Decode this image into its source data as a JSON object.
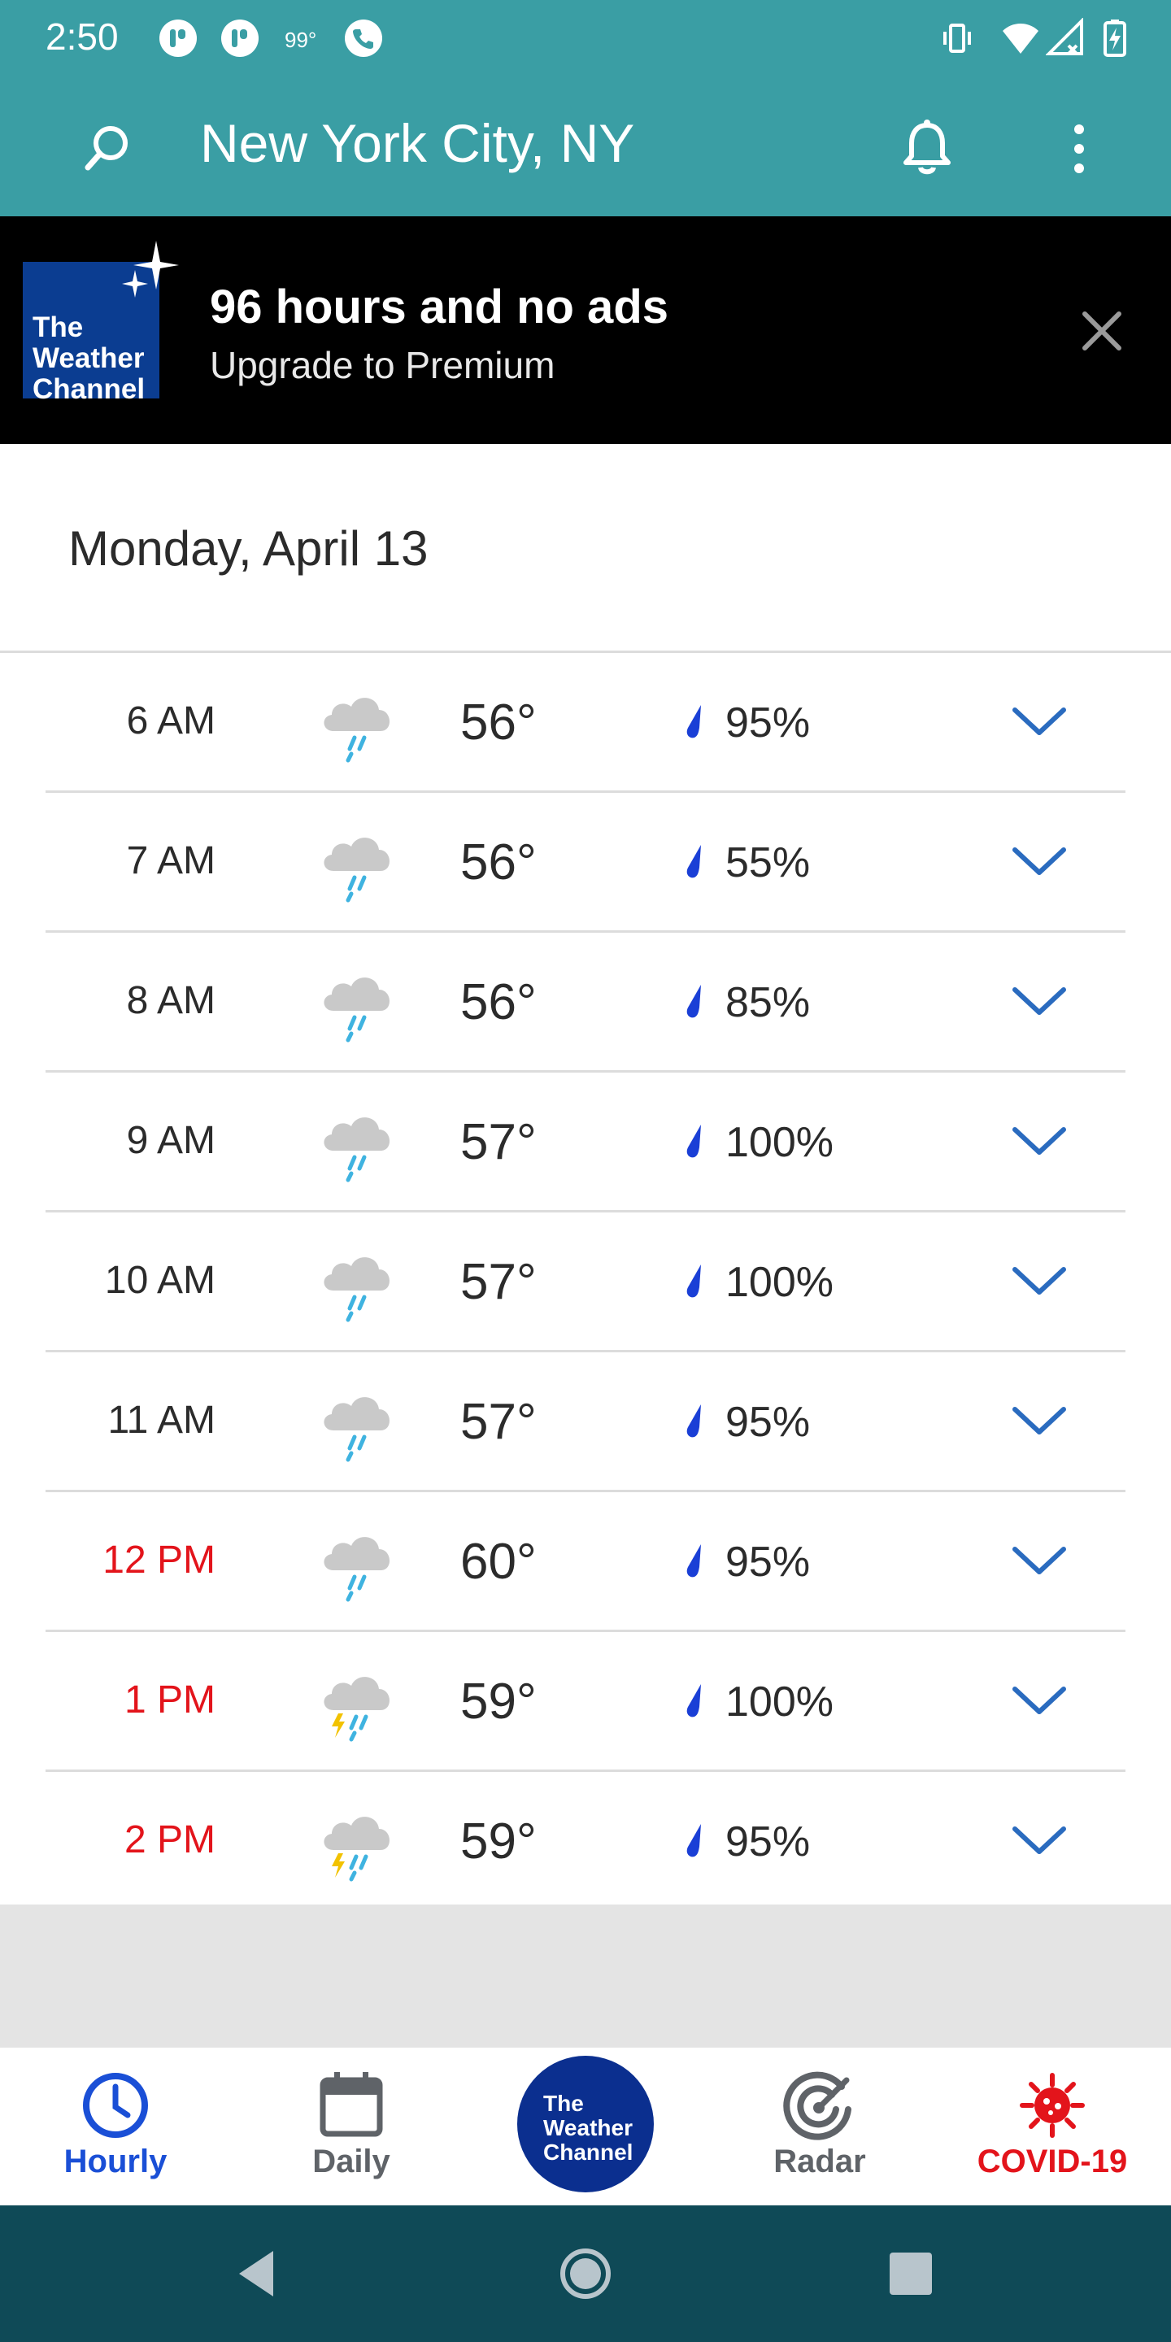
{
  "status_bar": {
    "time": "2:50",
    "temperature": "99°",
    "icons": [
      "app-icon",
      "app-icon",
      "phone-icon",
      "vibrate-icon",
      "wifi-icon",
      "signal-icon",
      "battery-charging-icon"
    ]
  },
  "app_bar": {
    "location": "New York City, NY",
    "search_icon": "search-icon",
    "bell_icon": "bell-icon",
    "menu_icon": "more-vert-icon"
  },
  "promo": {
    "logo_text_line1": "The",
    "logo_text_line2": "Weather",
    "logo_text_line3": "Channel",
    "headline": "96 hours and no ads",
    "subtext": "Upgrade to Premium"
  },
  "date_heading": "Monday, April 13",
  "hourly": [
    {
      "time": "6 AM",
      "temp": "56°",
      "precip": "95%",
      "condition": "rain",
      "highlight": false
    },
    {
      "time": "7 AM",
      "temp": "56°",
      "precip": "55%",
      "condition": "rain",
      "highlight": false
    },
    {
      "time": "8 AM",
      "temp": "56°",
      "precip": "85%",
      "condition": "rain",
      "highlight": false
    },
    {
      "time": "9 AM",
      "temp": "57°",
      "precip": "100%",
      "condition": "rain",
      "highlight": false
    },
    {
      "time": "10 AM",
      "temp": "57°",
      "precip": "100%",
      "condition": "rain",
      "highlight": false
    },
    {
      "time": "11 AM",
      "temp": "57°",
      "precip": "95%",
      "condition": "rain",
      "highlight": false
    },
    {
      "time": "12 PM",
      "temp": "60°",
      "precip": "95%",
      "condition": "rain",
      "highlight": true
    },
    {
      "time": "1 PM",
      "temp": "59°",
      "precip": "100%",
      "condition": "thunderstorm",
      "highlight": true
    },
    {
      "time": "2 PM",
      "temp": "59°",
      "precip": "95%",
      "condition": "thunderstorm",
      "highlight": true
    }
  ],
  "tabs": [
    {
      "label": "Hourly",
      "icon": "clock-icon",
      "color": "#1a4fd6",
      "active": true
    },
    {
      "label": "Daily",
      "icon": "calendar-icon",
      "color": "#5f6368",
      "active": false
    },
    {
      "label": "Radar",
      "icon": "radar-icon",
      "color": "#5f6368",
      "active": false
    },
    {
      "label": "COVID-19",
      "icon": "virus-icon",
      "color": "#e3141b",
      "active": false
    }
  ],
  "center_logo": {
    "line1": "The",
    "line2": "Weather",
    "line3": "Channel"
  },
  "colors": {
    "teal": "#3a9ea4",
    "navy": "#0b2f8f",
    "red": "#e3141b",
    "chevron": "#2a6bbf",
    "drop": "#1a3fd6"
  }
}
